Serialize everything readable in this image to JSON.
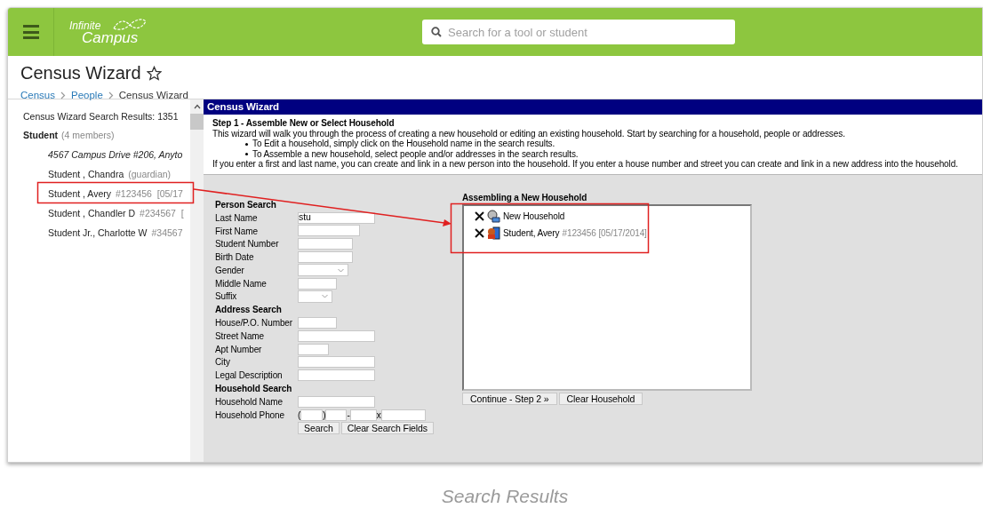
{
  "header": {
    "logo": [
      "Infinite",
      "Campus"
    ],
    "search": {
      "placeholder": "Search for a tool or student"
    }
  },
  "page": {
    "title": "Census Wizard",
    "favorite": false,
    "breadcrumbs": [
      "Census",
      "People",
      "Census Wizard"
    ]
  },
  "results": {
    "heading": "Census Wizard Search Results: 1351",
    "group": {
      "name": "Student",
      "note": "(4 members)"
    },
    "items": [
      {
        "kind": "address",
        "text": "4567 Campus Drive #206, Anyto"
      },
      {
        "kind": "person",
        "name": "Student , Chandra",
        "detail": "(guardian)"
      },
      {
        "kind": "person",
        "name": "Student , Avery",
        "detail": "#123456  [05/17"
      },
      {
        "kind": "person",
        "name": "Student , Chandler D",
        "detail": "#234567  ["
      },
      {
        "kind": "person",
        "name": "Student Jr., Charlotte W",
        "detail": "#34567"
      }
    ]
  },
  "wizard": {
    "title": "Census Wizard",
    "step": "Step 1 - Assemble New or Select Household",
    "intro": "This wizard will walk you through the process of creating a new household or editing an existing household. Start by searching for a household, people or addresses.",
    "bullets": [
      "To Edit a household, simply click on the Household name in the search results.",
      "To Assemble a new household, select people and/or addresses in the search results."
    ],
    "note": "If you enter a first and last name, you can create and link in a new person into the household. If you enter a house number and street you can create and link in a new address into the household.",
    "form": [
      {
        "kind": "heading",
        "label": "Person Search"
      },
      {
        "kind": "text",
        "label": "Last Name",
        "value": "stu"
      },
      {
        "kind": "text",
        "label": "First Name"
      },
      {
        "kind": "text",
        "label": "Student Number"
      },
      {
        "kind": "text",
        "label": "Birth Date"
      },
      {
        "kind": "select",
        "label": "Gender"
      },
      {
        "kind": "text",
        "label": "Middle Name"
      },
      {
        "kind": "select",
        "label": "Suffix"
      },
      {
        "kind": "heading",
        "label": "Address Search"
      },
      {
        "kind": "text",
        "label": "House/P.O. Number"
      },
      {
        "kind": "text",
        "label": "Street Name"
      },
      {
        "kind": "text",
        "label": "Apt Number"
      },
      {
        "kind": "text",
        "label": "City"
      },
      {
        "kind": "text",
        "label": "Legal Description"
      },
      {
        "kind": "heading",
        "label": "Household Search"
      },
      {
        "kind": "text",
        "label": "Household Name"
      },
      {
        "kind": "phone",
        "label": "Household Phone",
        "separators": [
          "(",
          ")",
          "-",
          "x"
        ]
      }
    ],
    "form_buttons": [
      "Search",
      "Clear Search Fields"
    ],
    "household": {
      "title": "Assembling a New Household",
      "members": [
        {
          "kind": "household",
          "name": "New Household"
        },
        {
          "kind": "student",
          "name": "Student, Avery",
          "detail": "#123456 [05/17/2014]"
        }
      ]
    },
    "household_buttons": [
      "Continue - Step 2 »",
      "Clear Household"
    ]
  },
  "caption": "Search Results"
}
